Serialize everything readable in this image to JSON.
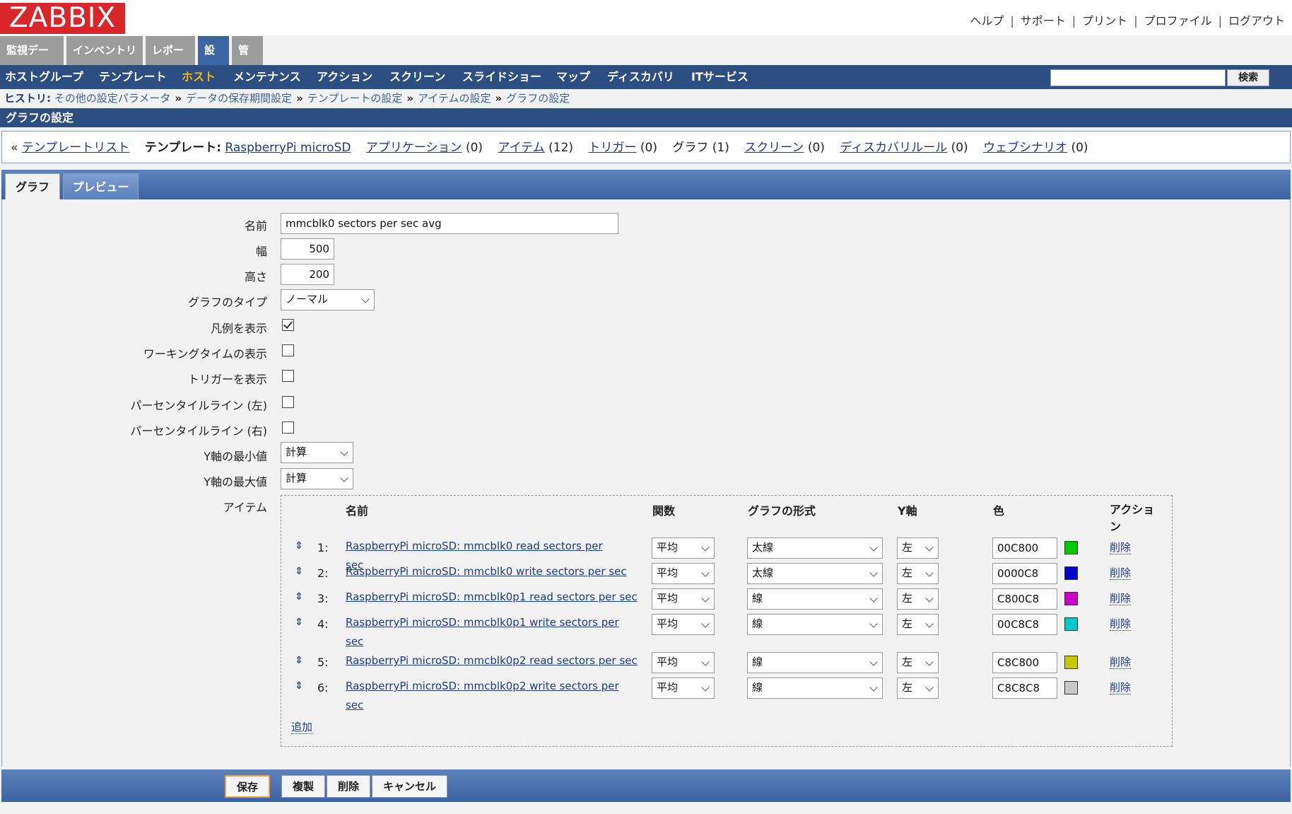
{
  "header": {
    "logo": "ZABBIX",
    "links": [
      "ヘルプ",
      "サポート",
      "プリント",
      "プロファイル",
      "ログアウト"
    ]
  },
  "menu": {
    "tabs": [
      "監視データ",
      "インベントリ",
      "レポート",
      "設定",
      "管理"
    ],
    "active": "設定"
  },
  "submenu": {
    "items": [
      "ホストグループ",
      "テンプレート",
      "ホスト",
      "メンテナンス",
      "アクション",
      "スクリーン",
      "スライドショー",
      "マップ",
      "ディスカバリ",
      "ITサービス"
    ],
    "active": "ホスト",
    "search_button": "検索",
    "search_value": ""
  },
  "history": {
    "label": "ヒストリ:",
    "items": [
      "その他の設定パラメータ",
      "データの保存期間設定",
      "テンプレートの設定",
      "アイテムの設定",
      "グラフの設定"
    ]
  },
  "page_title": "グラフの設定",
  "template_bar": {
    "back": "«",
    "template_list": "テンプレートリスト",
    "template_label": "テンプレート:",
    "template_name": "RaspberryPi microSD",
    "applications": "アプリケーション",
    "applications_count": "(0)",
    "items": "アイテム",
    "items_count": "(12)",
    "triggers": "トリガー",
    "triggers_count": "(0)",
    "graphs": "グラフ",
    "graphs_count": "(1)",
    "screens": "スクリーン",
    "screens_count": "(0)",
    "discovery": "ディスカバリルール",
    "discovery_count": "(0)",
    "web": "ウェブシナリオ",
    "web_count": "(0)"
  },
  "tabs": [
    "グラフ",
    "プレビュー"
  ],
  "form": {
    "name_label": "名前",
    "name_value": "mmcblk0 sectors per sec avg",
    "width_label": "幅",
    "width_value": "500",
    "height_label": "高さ",
    "height_value": "200",
    "type_label": "グラフのタイプ",
    "type_value": "ノーマル",
    "legend_label": "凡例を表示",
    "legend_checked": true,
    "worktime_label": "ワーキングタイムの表示",
    "worktime_checked": false,
    "triggers_label": "トリガーを表示",
    "triggers_checked": false,
    "pct_left_label": "パーセンタイルライン (左)",
    "pct_left_checked": false,
    "pct_right_label": "パーセンタイルライン (右)",
    "pct_right_checked": false,
    "ymin_label": "Y軸の最小値",
    "ymin_value": "計算",
    "ymax_label": "Y軸の最大値",
    "ymax_value": "計算",
    "items_label": "アイテム"
  },
  "items_table": {
    "headers": [
      "名前",
      "関数",
      "グラフの形式",
      "Y軸",
      "色",
      "アクション"
    ],
    "rows": [
      {
        "num": "1:",
        "name": "RaspberryPi microSD: mmcblk0 read sectors per sec",
        "func": "平均",
        "style": "太線",
        "yaxis": "左",
        "color": "00C800",
        "swatch": "#00c800",
        "action": "削除"
      },
      {
        "num": "2:",
        "name": "RaspberryPi microSD: mmcblk0 write sectors per sec",
        "func": "平均",
        "style": "太線",
        "yaxis": "左",
        "color": "0000C8",
        "swatch": "#0000c8",
        "action": "削除"
      },
      {
        "num": "3:",
        "name": "RaspberryPi microSD: mmcblk0p1 read sectors per sec",
        "func": "平均",
        "style": "線",
        "yaxis": "左",
        "color": "C800C8",
        "swatch": "#c800c8",
        "action": "削除"
      },
      {
        "num": "4:",
        "name": "RaspberryPi microSD: mmcblk0p1 write sectors per sec",
        "func": "平均",
        "style": "線",
        "yaxis": "左",
        "color": "00C8C8",
        "swatch": "#00c8c8",
        "action": "削除"
      },
      {
        "num": "5:",
        "name": "RaspberryPi microSD: mmcblk0p2 read sectors per sec",
        "func": "平均",
        "style": "線",
        "yaxis": "左",
        "color": "C8C800",
        "swatch": "#c8c800",
        "action": "削除"
      },
      {
        "num": "6:",
        "name": "RaspberryPi microSD: mmcblk0p2 write sectors per sec",
        "func": "平均",
        "style": "線",
        "yaxis": "左",
        "color": "C8C8C8",
        "swatch": "#c8c8c8",
        "action": "削除"
      }
    ],
    "add": "追加"
  },
  "footer": {
    "save": "保存",
    "clone": "複製",
    "delete": "削除",
    "cancel": "キャンセル"
  },
  "colors": {
    "logo": "#d8262a",
    "nav": "#2c4e80",
    "active_submenu": "#f7b500"
  }
}
